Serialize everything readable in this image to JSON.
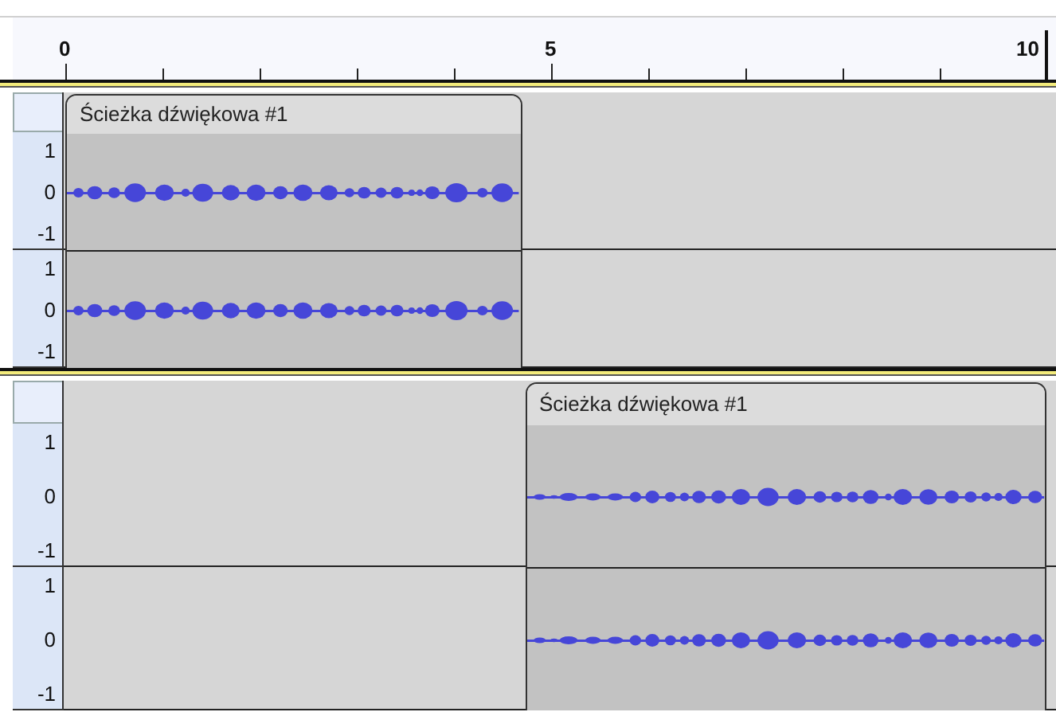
{
  "ruler": {
    "labels": [
      {
        "text": "0"
      },
      {
        "text": "5"
      },
      {
        "text": "10"
      }
    ]
  },
  "tracks": [
    {
      "clips": [
        {
          "title": "Ścieżka dźwiękowa #1"
        }
      ],
      "channels": [
        {
          "scale": [
            "1",
            "0",
            "-1"
          ]
        },
        {
          "scale": [
            "1",
            "0",
            "-1"
          ]
        }
      ]
    },
    {
      "clips": [
        {
          "title": "Ścieżka dźwiękowa #1"
        }
      ],
      "channels": [
        {
          "scale": [
            "1",
            "0",
            "-1"
          ]
        },
        {
          "scale": [
            "1",
            "0",
            "-1"
          ]
        }
      ]
    }
  ]
}
